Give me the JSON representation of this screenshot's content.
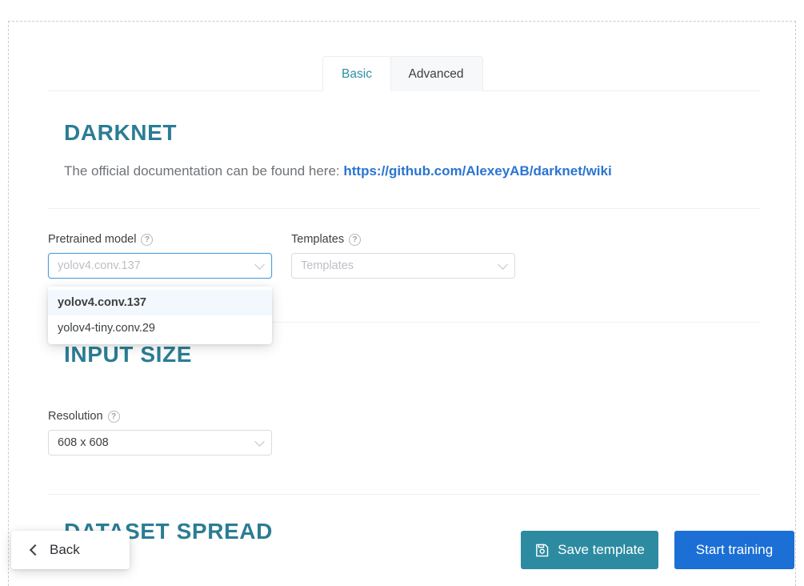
{
  "tabs": [
    {
      "label": "Basic",
      "active": true
    },
    {
      "label": "Advanced",
      "active": false
    }
  ],
  "sections": {
    "darknet": {
      "title": "DARKNET",
      "doc_prefix": "The official documentation can be found here:",
      "doc_link_text": "https://github.com/AlexeyAB/darknet/wiki"
    },
    "input_size": {
      "title": "INPUT SIZE"
    },
    "dataset_spread": {
      "title": "DATASET SPREAD"
    }
  },
  "fields": {
    "pretrained_model": {
      "label": "Pretrained model",
      "help": "?",
      "value": "yolov4.conv.137",
      "placeholder": "yolov4.conv.137",
      "focused": true,
      "options": [
        {
          "label": "yolov4.conv.137",
          "selected": true
        },
        {
          "label": "yolov4-tiny.conv.29",
          "selected": false
        }
      ]
    },
    "templates": {
      "label": "Templates",
      "help": "?",
      "value": "",
      "placeholder": "Templates",
      "focused": false
    },
    "resolution": {
      "label": "Resolution",
      "help": "?",
      "value": "608 x 608",
      "placeholder": "608 x 608",
      "focused": false
    }
  },
  "footer": {
    "back_label": "Back",
    "save_label": "Save template",
    "start_label": "Start training"
  },
  "colors": {
    "heading_teal": "#2b7d94",
    "tab_active_text": "#2f8ea3",
    "link_blue": "#2a74d2",
    "save_teal": "#2d8ba1",
    "start_blue": "#1b6fd5",
    "focus_blue": "#4a9fe0"
  }
}
